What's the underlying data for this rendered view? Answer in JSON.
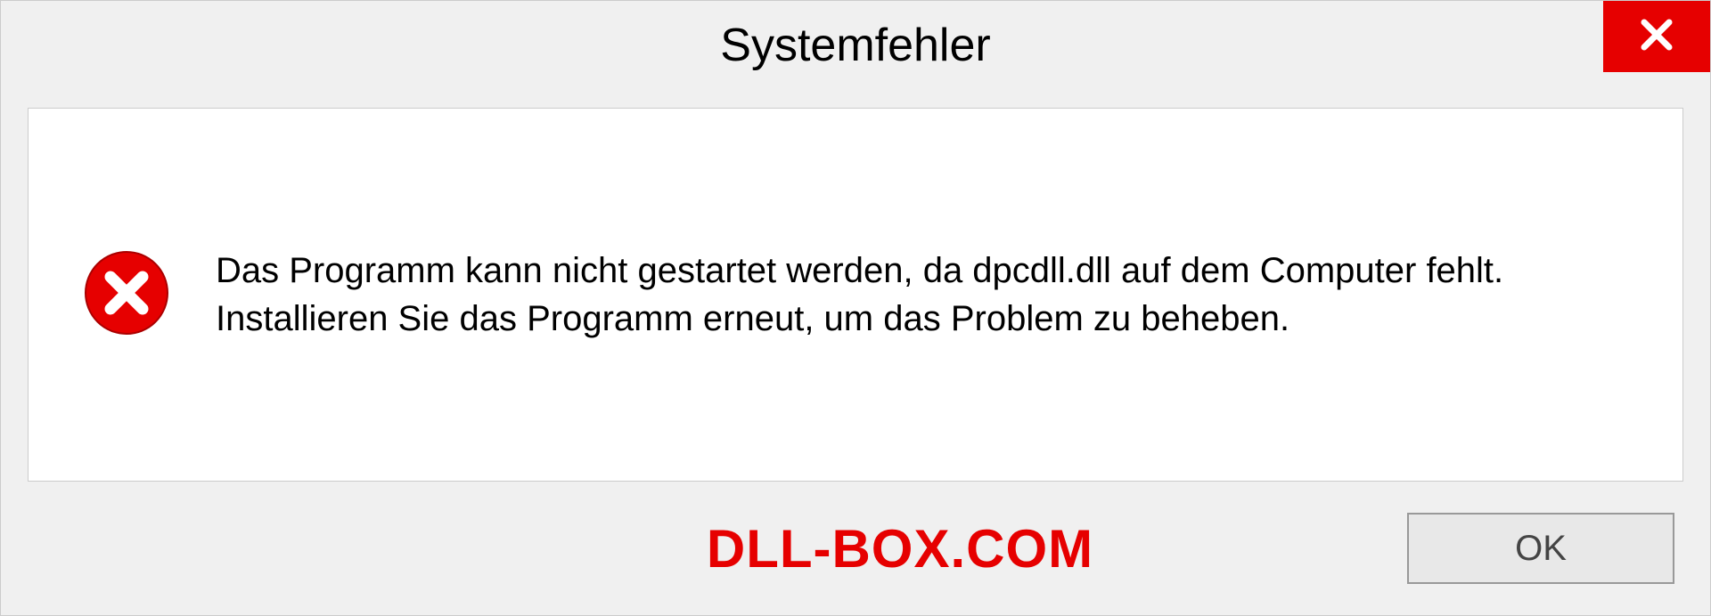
{
  "dialog": {
    "title": "Systemfehler",
    "message": "Das Programm kann nicht gestartet werden, da dpcdll.dll auf dem Computer fehlt. Installieren Sie das Programm erneut, um das Problem zu beheben.",
    "ok_label": "OK"
  },
  "watermark": "DLL-BOX.COM"
}
